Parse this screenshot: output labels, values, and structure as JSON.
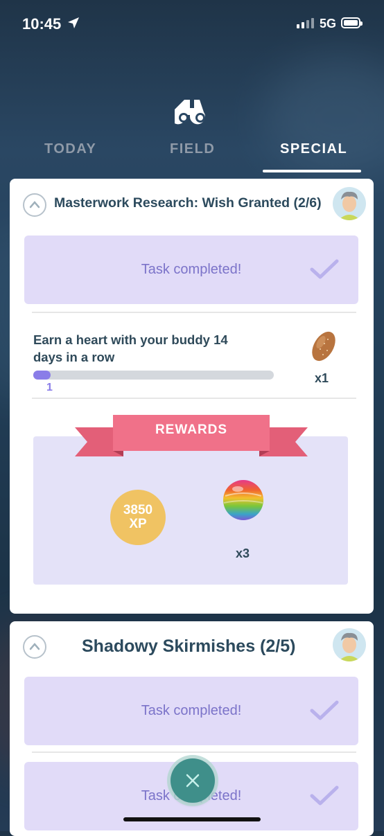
{
  "status_bar": {
    "time": "10:45",
    "network": "5G"
  },
  "tabs": [
    {
      "label": "TODAY",
      "active": false
    },
    {
      "label": "FIELD",
      "active": false
    },
    {
      "label": "SPECIAL",
      "active": true
    }
  ],
  "research_1": {
    "title": "Masterwork Research: Wish Granted (2/6)",
    "completed_task_label": "Task completed!",
    "current_task": {
      "description": "Earn a heart with your buddy 14 days in a row",
      "progress_value": 1,
      "progress_goal": 14,
      "reward_item": "golden-razz-berry-icon",
      "reward_qty": "x1"
    },
    "rewards": {
      "banner": "REWARDS",
      "xp_amount": "3850",
      "xp_unit": "XP",
      "candy_item": "rare-candy-icon",
      "candy_qty": "x3"
    }
  },
  "research_2": {
    "title": "Shadowy Skirmishes (2/5)",
    "completed_tasks": [
      "Task completed!",
      "Task completed!"
    ]
  },
  "colors": {
    "accent": "#8a7de8",
    "task_done_bg": "#e1dbf8",
    "title_text": "#2c4a5d",
    "ribbon": "#ef7287",
    "fab": "#3f8f8a"
  }
}
